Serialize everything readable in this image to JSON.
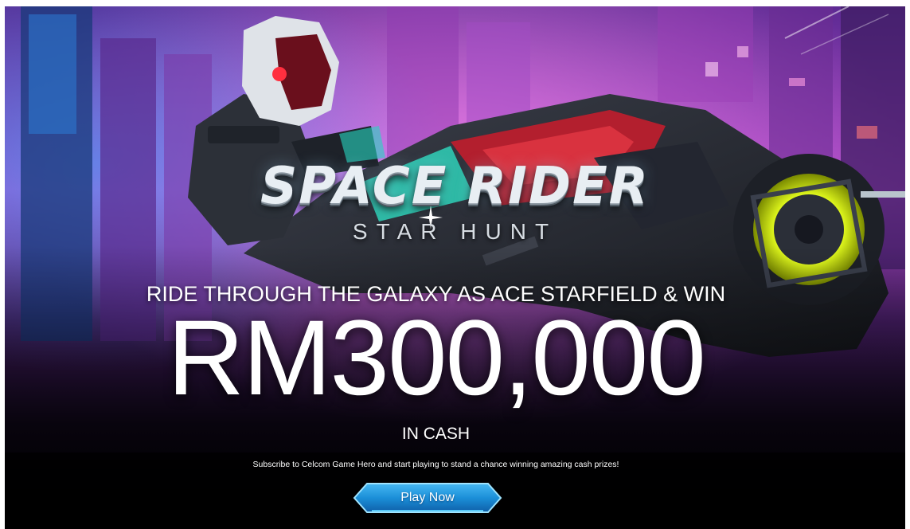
{
  "banner": {
    "logo_title": "SPACE RIDER",
    "logo_subtitle": "STAR HUNT",
    "headline": "RIDE THROUGH THE GALAXY AS ACE STARFIELD & WIN",
    "amount": "RM300,000",
    "amount_suffix": "IN CASH",
    "description": "Subscribe to Celcom Game Hero and start playing to stand a chance winning amazing cash prizes!",
    "cta_label": "Play Now"
  },
  "colors": {
    "background_dark": "#0b0716",
    "city_magenta": "#c44bd8",
    "city_blue": "#3a7de0",
    "button_blue": "#1b8fd8",
    "button_glow": "#5fd3ff",
    "text": "#ffffff"
  }
}
